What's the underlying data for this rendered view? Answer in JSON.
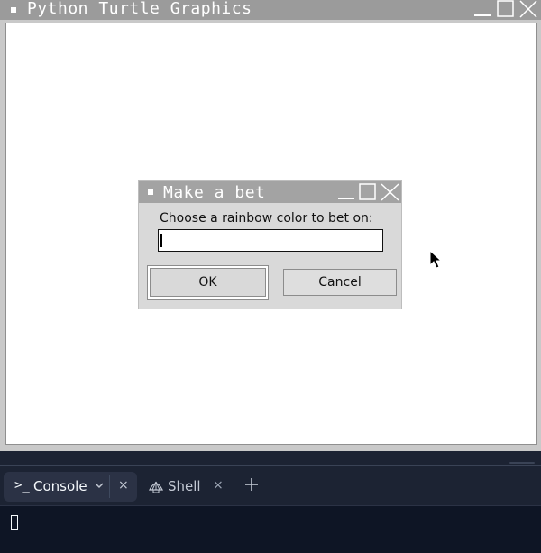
{
  "turtle_window": {
    "title": "Python Turtle Graphics"
  },
  "dialog": {
    "title": "Make a bet",
    "prompt": "Choose a rainbow color to bet on:",
    "input_value": "",
    "ok_label": "OK",
    "cancel_label": "Cancel"
  },
  "bottom_panel": {
    "tabs": [
      {
        "label": "Console",
        "icon": "terminal-prompt-icon",
        "active": true
      },
      {
        "label": "Shell",
        "icon": "shell-icon",
        "active": false
      }
    ],
    "console_prompt_glyph": ">_",
    "close_glyph": "×"
  },
  "colors": {
    "titlebar": "#9b9b9b",
    "dialog_bg": "#d9d9d9",
    "panel_bg": "#1c2333",
    "console_bg": "#0e1525"
  }
}
